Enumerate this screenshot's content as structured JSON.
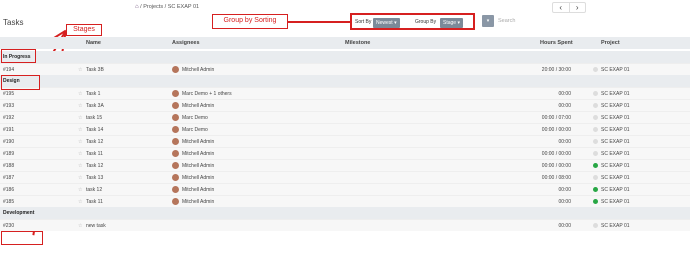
{
  "breadcrumb": {
    "home_icon": "home-icon",
    "projects": "Projects",
    "sep": "/",
    "current": "SC EXAP 01"
  },
  "pager": {
    "prev": "‹",
    "next": "›"
  },
  "title": "Tasks",
  "search": {
    "placeholder": "Search"
  },
  "sort": {
    "sort_by_label": "Sort By",
    "sort_value": "Newest",
    "group_by_label": "Group By",
    "group_value": "Stage"
  },
  "annotations": {
    "stages": "Stages",
    "group_sort": "Group by Sorting"
  },
  "columns": [
    "Name",
    "Assignees",
    "Milestone",
    "Hours Spent",
    "Project"
  ],
  "groups": [
    {
      "label": "In Progress",
      "rows": [
        {
          "id": "#194",
          "name": "Task 3B",
          "assignee": "Mitchell Admin",
          "hours": "20:00 / 30:00",
          "project": "SC EXAP 01",
          "status": "none"
        }
      ]
    },
    {
      "label": "Design",
      "rows": [
        {
          "id": "#195",
          "name": "Task 1",
          "assignee": "Marc Demo + 1 others",
          "hours": "00:00",
          "project": "SC EXAP 01",
          "status": "none"
        },
        {
          "id": "#193",
          "name": "Task 3A",
          "assignee": "Mitchell Admin",
          "hours": "00:00",
          "project": "SC EXAP 01",
          "status": "none"
        },
        {
          "id": "#192",
          "name": "task 15",
          "assignee": "Marc Demo",
          "hours": "00:00 / 07:00",
          "project": "SC EXAP 01",
          "status": "none"
        },
        {
          "id": "#191",
          "name": "Task 14",
          "assignee": "Marc Demo",
          "hours": "00:00 / 00:00",
          "project": "SC EXAP 01",
          "status": "none"
        },
        {
          "id": "#190",
          "name": "Task 12",
          "assignee": "Mitchell Admin",
          "hours": "00:00",
          "project": "SC EXAP 01",
          "status": "none"
        },
        {
          "id": "#189",
          "name": "Task 11",
          "assignee": "Mitchell Admin",
          "hours": "00:00 / 00:00",
          "project": "SC EXAP 01",
          "status": "none"
        },
        {
          "id": "#188",
          "name": "Task 12",
          "assignee": "Mitchell Admin",
          "hours": "00:00 / 00:00",
          "project": "SC EXAP 01",
          "status": "done"
        },
        {
          "id": "#187",
          "name": "Task 13",
          "assignee": "Mitchell Admin",
          "hours": "00:00 / 08:00",
          "project": "SC EXAP 01",
          "status": "none"
        },
        {
          "id": "#186",
          "name": "task 12",
          "assignee": "Mitchell Admin",
          "hours": "00:00",
          "project": "SC EXAP 01",
          "status": "done"
        },
        {
          "id": "#185",
          "name": "Task 11",
          "assignee": "Mitchell Admin",
          "hours": "00:00",
          "project": "SC EXAP 01",
          "status": "done"
        }
      ]
    },
    {
      "label": "Development",
      "rows": [
        {
          "id": "#230",
          "name": "new task",
          "assignee": "",
          "hours": "00:00",
          "project": "SC EXAP 01",
          "status": "none"
        }
      ]
    }
  ],
  "colors": {
    "accent_red": "#d62020",
    "dropdown": "#7b8a99",
    "done": "#28a745"
  }
}
